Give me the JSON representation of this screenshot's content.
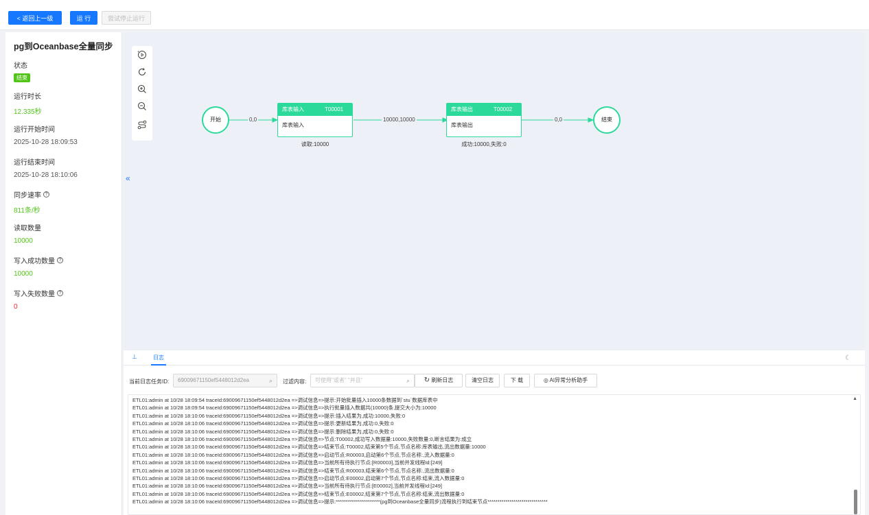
{
  "toolbar": {
    "back_label": "<  返回上一级",
    "run_label": "运 行",
    "stop_label": "尝试停止运行"
  },
  "info": {
    "title": "pg到Oceanbase全量同步",
    "status_label": "状态",
    "status_value": "结束",
    "duration_label": "运行时长",
    "duration_value": "12.335秒",
    "start_label": "运行开始时间",
    "start_value": "2025-10-28 18:09:53",
    "end_label": "运行结束时间",
    "end_value": "2025-10-28 18:10:06",
    "rate_label": "同步速率",
    "rate_value": "811条/秒",
    "read_label": "读取数量",
    "read_value": "10000",
    "write_ok_label": "写入成功数量",
    "write_ok_value": "10000",
    "write_fail_label": "写入失败数量",
    "write_fail_value": "0"
  },
  "flow": {
    "start_node": "开始",
    "end_node": "结束",
    "node1": {
      "name": "库表输入",
      "code": "T00001",
      "body": "库表输入",
      "foot": "读取:10000"
    },
    "node2": {
      "name": "库表输出",
      "code": "T00002",
      "body": "库表输出",
      "foot": "成功:10000,失败:0"
    },
    "edge1": "0,0",
    "edge2": "10000,10000",
    "edge3": "0,0",
    "collapse": "«"
  },
  "logs": {
    "tab_label": "日志",
    "task_id_label": "当前日志任务ID:",
    "task_id_value": "69009671150ef5448012d2ea",
    "filter_label": "过滤内容:",
    "filter_placeholder": "可使用\"或者\" \"并且\"",
    "refresh_label": "刷新日志",
    "clear_label": "清空日志",
    "download_label": "下 载",
    "ai_label": "AI异常分析助手",
    "lines": [
      "ETL01:admin at 10/28 18:09:54 traceId:69009671150ef5448012d2ea =>调试信息=>提示:开始批量插入10000条数据到`stu`数据库表中",
      "ETL01:admin at 10/28 18:09:54 traceId:69009671150ef5448012d2ea =>调试信息=>执行批量插入数据共(10000)条,提交大小为:10000",
      "ETL01:admin at 10/28 18:10:06 traceId:69009671150ef5448012d2ea =>调试信息=>提示:插入结果为,成功:10000,失败:0",
      "ETL01:admin at 10/28 18:10:06 traceId:69009671150ef5448012d2ea =>调试信息=>提示:更新结果为,成功:0,失败:0",
      "ETL01:admin at 10/28 18:10:06 traceId:69009671150ef5448012d2ea =>调试信息=>提示:删除结果为,成功:0,失败:0",
      "ETL01:admin at 10/28 18:10:06 traceId:69009671150ef5448012d2ea =>调试信息=>节点:T00002,成功写入数据量:10000,失败数量:0,断言结果为:成立",
      "ETL01:admin at 10/28 18:10:06 traceId:69009671150ef5448012d2ea =>调试信息=>结束节点:T00002,结束第5个节点,节点名称:库表输出,流出数据量:10000",
      "ETL01:admin at 10/28 18:10:06 traceId:69009671150ef5448012d2ea =>调试信息=>启动节点:R00003,启动第6个节点,节点名称:,流入数据量:0",
      "ETL01:admin at 10/28 18:10:06 traceId:69009671150ef5448012d2ea =>调试信息=>当前所有待执行节点:[R00003],当前并发线程Id:[249]",
      "ETL01:admin at 10/28 18:10:06 traceId:69009671150ef5448012d2ea =>调试信息=>结束节点:R00003,结束第6个节点,节点名称:,流出数据量:0",
      "ETL01:admin at 10/28 18:10:06 traceId:69009671150ef5448012d2ea =>调试信息=>启动节点:E00002,启动第7个节点,节点名称:结束,流入数据量:0",
      "ETL01:admin at 10/28 18:10:06 traceId:69009671150ef5448012d2ea =>调试信息=>当前所有待执行节点:[E00002],当前并发线程Id:[249]",
      "ETL01:admin at 10/28 18:10:06 traceId:69009671150ef5448012d2ea =>调试信息=>结束节点:E00002,结束第7个节点,节点名称:结束,流出数据量:0",
      "ETL01:admin at 10/28 18:10:06 traceId:69009671150ef5448012d2ea =>调试信息=>提示:**********************(pg到Oceanbase全量同步)流程执行到结束节点******************************"
    ]
  },
  "colors": {
    "primary": "#1677ff",
    "success": "#52c41a",
    "node": "#2bd99a",
    "error": "#f5222d"
  },
  "icons": [
    "play-history-icon",
    "refresh-icon",
    "zoom-in-icon",
    "zoom-out-icon",
    "layout-icon",
    "search-icon",
    "moon-icon"
  ]
}
